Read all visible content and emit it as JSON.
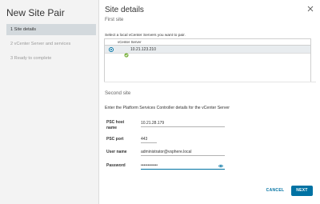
{
  "wizard": {
    "title": "New Site Pair",
    "steps": [
      {
        "label": "1 Site details"
      },
      {
        "label": "2 vCenter Server and services"
      },
      {
        "label": "3 Ready to complete"
      }
    ]
  },
  "page": {
    "title": "Site details",
    "section1": "First site",
    "instruction": "Select a local vCenter Servers you want to pair.",
    "table": {
      "column": "vCenter Server",
      "rows": [
        {
          "name": "10.21.123.210",
          "selected": true
        }
      ]
    },
    "section2": "Second site",
    "psc_instruction": "Enter the Platform Services Controller details for the vCenter Server",
    "fields": {
      "host_label": "PSC host name",
      "host_value": "10.21.28.179",
      "port_label": "PSC port",
      "port_value": "443",
      "user_label": "User name",
      "user_value": "administrator@vsphere.local",
      "password_label": "Password",
      "password_value": "••••••••••••"
    }
  },
  "buttons": {
    "cancel": "CANCEL",
    "next": "NEXT"
  },
  "colors": {
    "accent": "#0072a3",
    "nav_bg": "#f3f3f3",
    "active_step": "#d3d9dd",
    "vc_icon": "#7cb342"
  }
}
